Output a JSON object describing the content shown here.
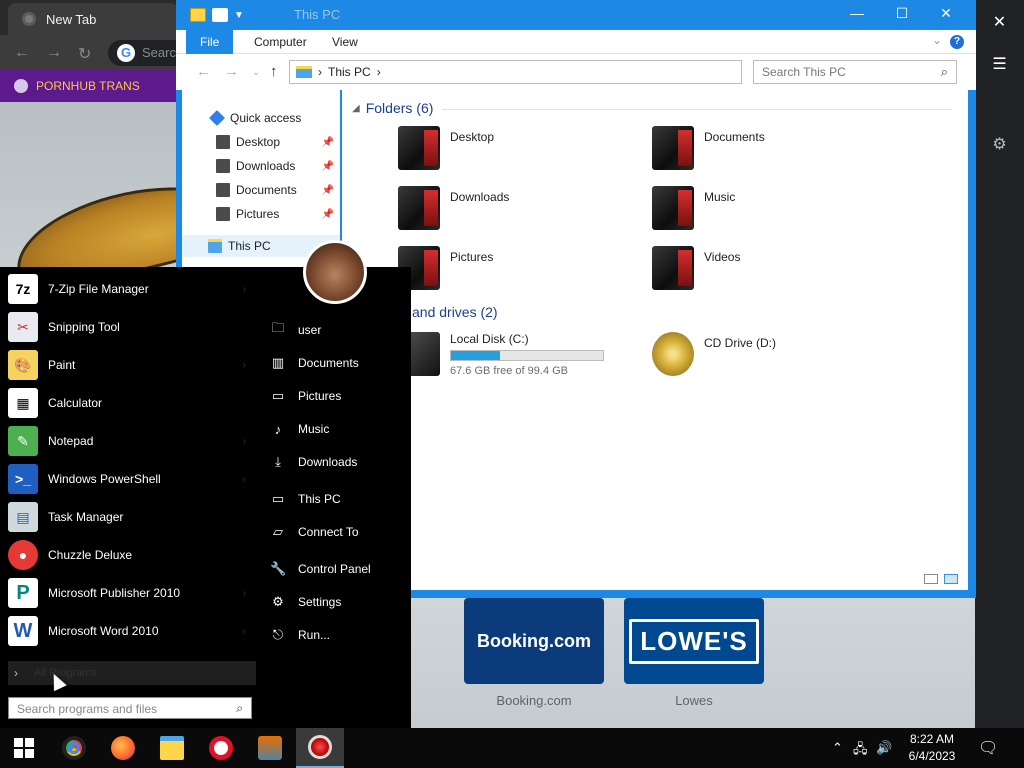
{
  "browser": {
    "tab_title": "New Tab",
    "omnibox_placeholder": "Searc",
    "bookmark": "PORNHUB TRANS",
    "tiles": [
      {
        "name": "Booking.com",
        "label": "Booking.com"
      },
      {
        "name": "LOWE'S",
        "label": "Lowes"
      }
    ]
  },
  "explorer": {
    "title": "This PC",
    "ribbon_tabs": [
      "File",
      "Computer",
      "View"
    ],
    "address": "This PC",
    "search_placeholder": "Search This PC",
    "nav": {
      "quick_access": "Quick access",
      "items": [
        "Desktop",
        "Downloads",
        "Documents",
        "Pictures"
      ],
      "this_pc": "This PC"
    },
    "folders_header": "Folders (6)",
    "folders": [
      "Desktop",
      "Documents",
      "Downloads",
      "Music",
      "Pictures",
      "Videos"
    ],
    "drives_header": "and drives (2)",
    "drives": [
      {
        "name": "Local Disk (C:)",
        "free": "67.6 GB free of 99.4 GB",
        "used_fraction": 0.32
      },
      {
        "name": "CD Drive (D:)"
      }
    ]
  },
  "startmenu": {
    "apps": [
      {
        "label": "7-Zip File Manager",
        "icon": "7z"
      },
      {
        "label": "Snipping Tool",
        "icon": "snip"
      },
      {
        "label": "Paint",
        "icon": "paint"
      },
      {
        "label": "Calculator",
        "icon": "calc"
      },
      {
        "label": "Notepad",
        "icon": "notepad"
      },
      {
        "label": "Windows PowerShell",
        "icon": "ps"
      },
      {
        "label": "Task Manager",
        "icon": "tm"
      },
      {
        "label": "Chuzzle Deluxe",
        "icon": "ch"
      },
      {
        "label": "Microsoft Publisher 2010",
        "icon": "P"
      },
      {
        "label": "Microsoft Word 2010",
        "icon": "W"
      }
    ],
    "all_programs": "All Programs",
    "search_placeholder": "Search programs and files",
    "right": [
      "user",
      "Documents",
      "Pictures",
      "Music",
      "Downloads",
      "This PC",
      "Connect To",
      "Control Panel",
      "Settings",
      "Run..."
    ]
  },
  "taskbar": {
    "time": "8:22 AM",
    "date": "6/4/2023"
  }
}
